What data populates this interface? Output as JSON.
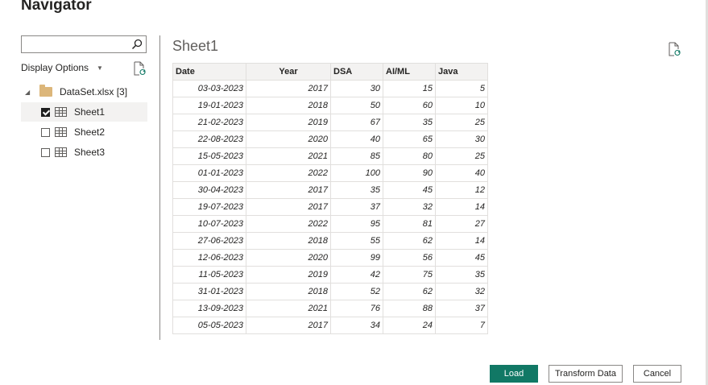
{
  "dialog": {
    "title": "Navigator"
  },
  "search": {
    "placeholder": "",
    "value": ""
  },
  "display_options": {
    "label": "Display Options",
    "icon": "chevron-down-icon"
  },
  "tree": {
    "root": {
      "label": "DataSet.xlsx [3]",
      "icon": "folder-icon",
      "expanded": true
    },
    "items": [
      {
        "label": "Sheet1",
        "checked": true,
        "selected": true,
        "icon": "table-icon"
      },
      {
        "label": "Sheet2",
        "checked": false,
        "selected": false,
        "icon": "table-icon"
      },
      {
        "label": "Sheet3",
        "checked": false,
        "selected": false,
        "icon": "table-icon"
      }
    ]
  },
  "preview": {
    "title": "Sheet1",
    "columns": [
      "Date",
      "Year",
      "DSA",
      "AI/ML",
      "Java"
    ],
    "rows": [
      [
        "03-03-2023",
        "2017",
        "30",
        "15",
        "5"
      ],
      [
        "19-01-2023",
        "2018",
        "50",
        "60",
        "10"
      ],
      [
        "21-02-2023",
        "2019",
        "67",
        "35",
        "25"
      ],
      [
        "22-08-2023",
        "2020",
        "40",
        "65",
        "30"
      ],
      [
        "15-05-2023",
        "2021",
        "85",
        "80",
        "25"
      ],
      [
        "01-01-2023",
        "2022",
        "100",
        "90",
        "40"
      ],
      [
        "30-04-2023",
        "2017",
        "35",
        "45",
        "12"
      ],
      [
        "19-07-2023",
        "2017",
        "37",
        "32",
        "14"
      ],
      [
        "10-07-2023",
        "2022",
        "95",
        "81",
        "27"
      ],
      [
        "27-06-2023",
        "2018",
        "55",
        "62",
        "14"
      ],
      [
        "12-06-2023",
        "2020",
        "99",
        "56",
        "45"
      ],
      [
        "11-05-2023",
        "2019",
        "42",
        "75",
        "35"
      ],
      [
        "31-01-2023",
        "2018",
        "52",
        "62",
        "32"
      ],
      [
        "13-09-2023",
        "2021",
        "76",
        "88",
        "37"
      ],
      [
        "05-05-2023",
        "2017",
        "34",
        "24",
        "7"
      ]
    ]
  },
  "buttons": {
    "load": "Load",
    "transform": "Transform Data",
    "cancel": "Cancel"
  },
  "colors": {
    "primary": "#117865",
    "border": "#8a8886",
    "selected_bg": "#f3f2f1"
  }
}
